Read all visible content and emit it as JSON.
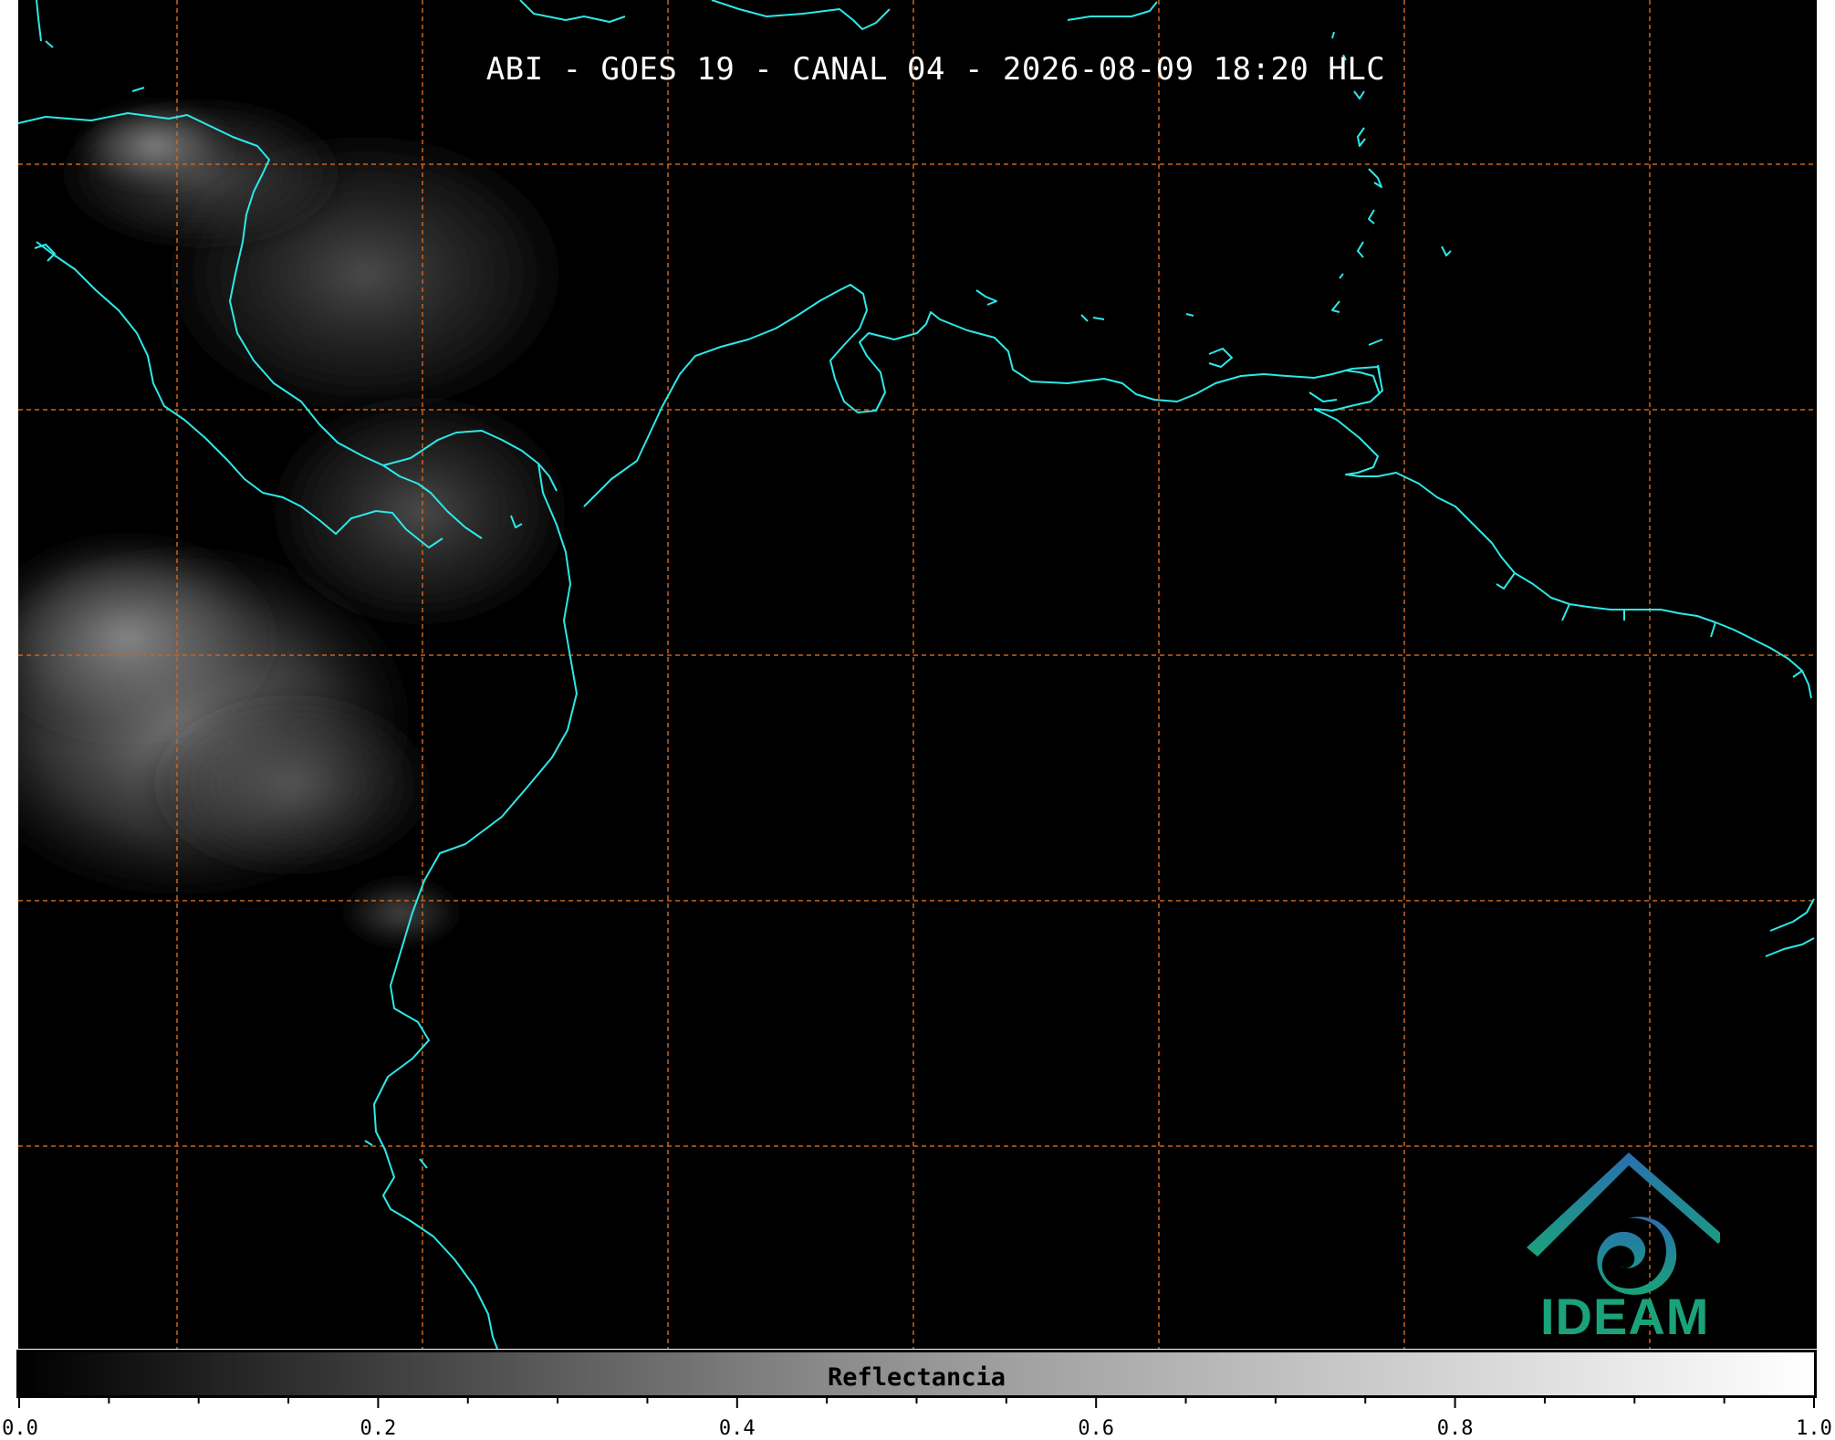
{
  "title": "ABI - GOES 19 - CANAL 04 - 2026-08-09 18:20 HLC",
  "map": {
    "background_color": "#000000",
    "coastline_color": "#2ee8e8",
    "gridline_color": "#c9651e",
    "cloud_color": "#7a7a7a"
  },
  "logo": {
    "text": "IDEAM",
    "color_primary": "#1aa27a",
    "color_secondary": "#2a6fb0"
  },
  "colorbar": {
    "label": "Reflectancia",
    "min": 0.0,
    "max": 1.0,
    "ticks": [
      "0.0",
      "0.2",
      "0.4",
      "0.6",
      "0.8",
      "1.0"
    ],
    "minor_step": 0.05,
    "colormap": "grayscale"
  }
}
